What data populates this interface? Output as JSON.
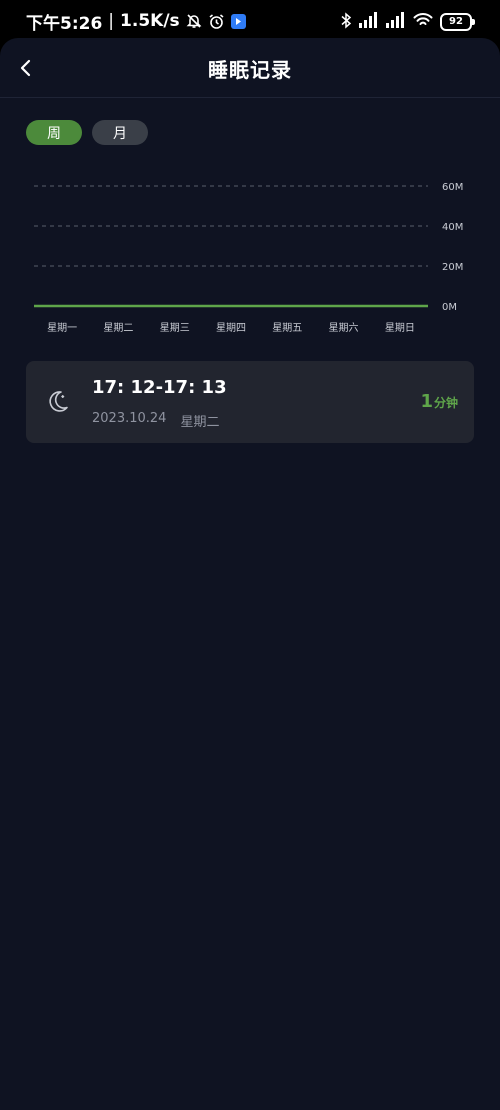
{
  "status_bar": {
    "time": "下午5:26",
    "separator": "|",
    "network_speed": "1.5K/s",
    "battery": "92",
    "icons": [
      "mute-bell-icon",
      "alarm-icon",
      "app-notification-icon",
      "bluetooth-icon",
      "signal-icon",
      "signal-icon",
      "wifi-icon",
      "battery-icon"
    ]
  },
  "header": {
    "title": "睡眠记录",
    "back_icon": "chevron-left-icon"
  },
  "tabs": [
    {
      "label": "周",
      "active": true
    },
    {
      "label": "月",
      "active": false
    }
  ],
  "colors": {
    "background": "#0f1322",
    "accent_green": "#4c8a3b",
    "value_green": "#5fa54a",
    "card": "#22252f"
  },
  "chart_data": {
    "type": "line",
    "categories": [
      "星期一",
      "星期二",
      "星期三",
      "星期四",
      "星期五",
      "星期六",
      "星期日"
    ],
    "series": [
      {
        "values": [
          0,
          0,
          0,
          0,
          0,
          0,
          0
        ]
      }
    ],
    "y_ticks": [
      "60M",
      "40M",
      "20M",
      "0M"
    ],
    "ylim": [
      0,
      60
    ],
    "grid": "dashed horizontal",
    "title": "",
    "xlabel": "",
    "ylabel": ""
  },
  "record": {
    "time_range": "17: 12-17: 13",
    "date": "2023.10.24",
    "weekday": "星期二",
    "duration_value": "1",
    "duration_unit": "分钟",
    "icon": "moon-icon"
  }
}
